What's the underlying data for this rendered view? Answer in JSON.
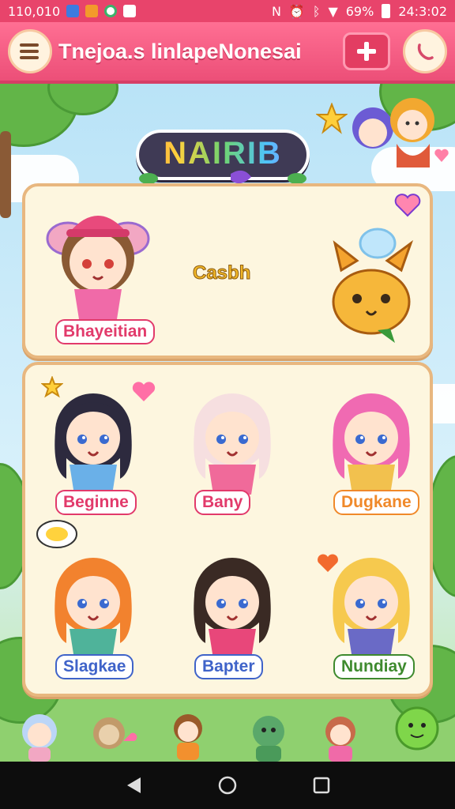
{
  "status_bar": {
    "left_text": "110,010",
    "battery": "69%",
    "time": "24:3:02",
    "icons": [
      "app-blue-icon",
      "app-orange-icon",
      "app-green-icon",
      "app-sheet-icon",
      "nfc-icon",
      "alarm-icon",
      "bluetooth-icon",
      "wifi-icon",
      "battery-icon"
    ]
  },
  "header": {
    "title": "Tnejoa.s linlapeNonesai",
    "menu_icon": "menu-icon",
    "add_icon": "plus-icon",
    "call_icon": "phone-icon"
  },
  "logo": {
    "text": "NAIRIB"
  },
  "featured": {
    "character_name": "Bhayeitian",
    "center_text": "Casbh",
    "pet_icon": "fox-pet-icon"
  },
  "characters": [
    {
      "name": "Beginne",
      "hair": "#2d2a3e",
      "outfit": "#6ab0e8",
      "label_color": "#e23a6b"
    },
    {
      "name": "Bany",
      "hair": "#f6dfe0",
      "outfit": "#f06a9a",
      "label_color": "#e23a6b"
    },
    {
      "name": "Dugkane",
      "hair": "#f06ab2",
      "outfit": "#f2c14e",
      "label_color": "#f0892a"
    },
    {
      "name": "Slagkae",
      "hair": "#f2822e",
      "outfit": "#4fb39a",
      "label_color": "#3f63c9"
    },
    {
      "name": "Bapter",
      "hair": "#3a2a24",
      "outfit": "#e8477a",
      "label_color": "#3f63c9"
    },
    {
      "name": "Nundiay",
      "hair": "#f6c94e",
      "outfit": "#6a6ac6",
      "label_color": "#3e8a2e"
    }
  ],
  "colors": {
    "accent": "#e8446b",
    "panel_bg": "#fdf6df",
    "panel_border": "#e8b77f"
  }
}
